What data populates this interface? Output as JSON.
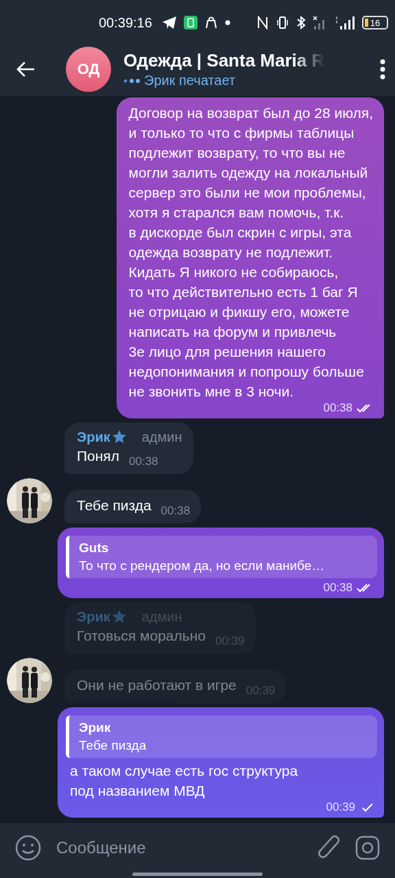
{
  "status_bar": {
    "time": "00:39:16",
    "battery": "16"
  },
  "header": {
    "avatar_initials": "ОД",
    "title": "Одежда | Santa Maria R",
    "status": "Эрик печатает"
  },
  "messages": [
    {
      "kind": "outgoing",
      "text": "Договор на возврат был до 28 июля,\nи только то что с фирмы таблицы\nподлежит возврату, то что вы не\nмогли залить одежду на локальный\nсервер это были не мои проблемы,\nхотя я старался вам помочь, т.к.\nв дискорде был скрин с игры, эта\nодежда возврату не подлежит.\nКидать Я никого не собираюсь,\nто что действительно есть 1 баг Я\nне отрицаю и фикшу его, можете\nнаписать на форум и привлечь\n3е лицо для решения нашего\nнедопонимания и попрошу больше\nне звонить мне в 3 ночи.",
      "time": "00:38",
      "read": true
    },
    {
      "kind": "incoming",
      "sender": "Эрик",
      "role": "админ",
      "text": "Понял",
      "time": "00:38",
      "avatar": false,
      "dimmed": false
    },
    {
      "kind": "incoming",
      "text": "Тебе пизда",
      "time": "00:38",
      "avatar": true,
      "dimmed": false
    },
    {
      "kind": "outgoing",
      "reply": {
        "author": "Guts",
        "text": "То что с рендером да, но если манибе…"
      },
      "time": "00:38",
      "read": true
    },
    {
      "kind": "incoming",
      "sender": "Эрик",
      "role": "админ",
      "text": "Готовься морально",
      "time": "00:39",
      "avatar": false,
      "dimmed": true
    },
    {
      "kind": "incoming",
      "text": "Они не работают в игре",
      "time": "00:39",
      "avatar": true,
      "dimmed": true
    },
    {
      "kind": "outgoing",
      "reply": {
        "author": "Эрик",
        "text": "Тебе пизда"
      },
      "text": "а таком случае есть гос структура\nпод названием МВД",
      "time": "00:39",
      "read": false
    }
  ],
  "composer": {
    "placeholder": "Сообщение"
  }
}
